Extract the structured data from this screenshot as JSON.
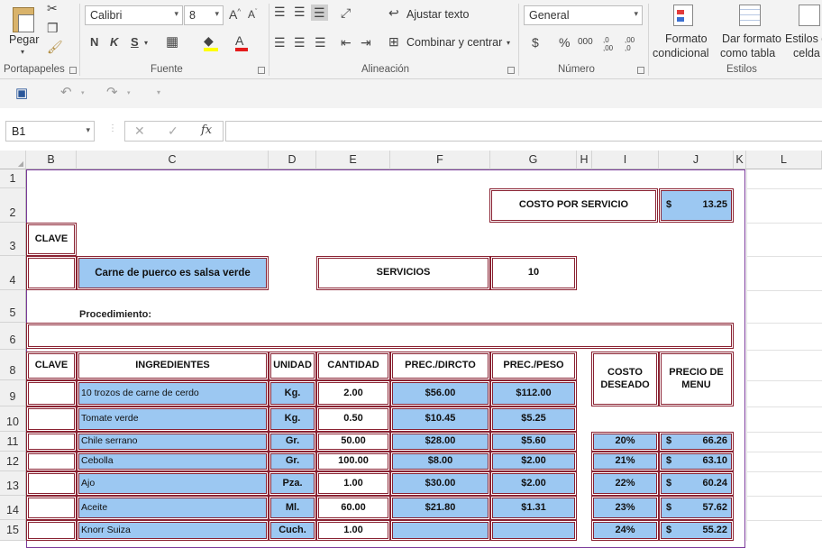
{
  "ribbon": {
    "clipboard": {
      "paste_label": "Pegar",
      "group_label": "Portapapeles"
    },
    "font": {
      "family": "Calibri",
      "size": "8",
      "group_label": "Fuente",
      "bold": "N",
      "italic": "K",
      "underline": "S"
    },
    "alignment": {
      "wrap_text": "Ajustar texto",
      "merge_center": "Combinar y centrar",
      "group_label": "Alineación"
    },
    "number": {
      "format": "General",
      "currency": "$",
      "percent": "%",
      "thousands": "000",
      "inc_decimals": ",0 ,00",
      "dec_decimals": ",00 ,0",
      "group_label": "Número"
    },
    "styles": {
      "cond_format_1": "Formato",
      "cond_format_2": "condicional",
      "table_format_1": "Dar formato",
      "table_format_2": "como tabla",
      "cell_styles_1": "Estilos de",
      "cell_styles_2": "celda",
      "group_label": "Estilos"
    }
  },
  "formula_bar": {
    "name_box": "B1",
    "fx": "fx",
    "formula": ""
  },
  "columns": [
    "B",
    "C",
    "D",
    "E",
    "F",
    "G",
    "H",
    "I",
    "J",
    "K",
    "L"
  ],
  "rows": [
    "1",
    "2",
    "3",
    "4",
    "5",
    "6",
    "8",
    "9",
    "10",
    "11",
    "12",
    "13",
    "14",
    "15"
  ],
  "sheet": {
    "costo_servicio_label": "COSTO POR SERVICIO",
    "costo_servicio_currency": "$",
    "costo_servicio_value": "13.25",
    "clave_label": "CLAVE",
    "dish_name": "Carne de puerco es salsa verde",
    "servicios_label": "SERVICIOS",
    "servicios_value": "10",
    "procedimiento_label": "Procedimiento:",
    "table_headers": {
      "clave": "CLAVE",
      "ingredientes": "INGREDIENTES",
      "unidad": "UNIDAD",
      "cantidad": "CANTIDAD",
      "prec_directo": "PREC./DIRCTO",
      "prec_peso": "PREC./PESO"
    },
    "side_headers": {
      "costo_deseado": "COSTO DESEADO",
      "precio_menu": "PRECIO DE MENU"
    },
    "ingredients": [
      {
        "name": "10 trozos de carne de cerdo",
        "unit": "Kg.",
        "qty": "2.00",
        "direct": "$56.00",
        "weight": "$112.00"
      },
      {
        "name": "Tomate verde",
        "unit": "Kg.",
        "qty": "0.50",
        "direct": "$10.45",
        "weight": "$5.25"
      },
      {
        "name": "Chile serrano",
        "unit": "Gr.",
        "qty": "50.00",
        "direct": "$28.00",
        "weight": "$5.60"
      },
      {
        "name": "Cebolla",
        "unit": "Gr.",
        "qty": "100.00",
        "direct": "$8.00",
        "weight": "$2.00"
      },
      {
        "name": "Ajo",
        "unit": "Pza.",
        "qty": "1.00",
        "direct": "$30.00",
        "weight": "$2.00"
      },
      {
        "name": "Aceite",
        "unit": "Ml.",
        "qty": "60.00",
        "direct": "$21.80",
        "weight": "$1.31"
      },
      {
        "name": "Knorr Suiza",
        "unit": "Cuch.",
        "qty": "1.00",
        "direct": "",
        "weight": ""
      }
    ],
    "menu_prices": [
      {
        "pct": "20%",
        "cur": "$",
        "price": "66.26"
      },
      {
        "pct": "21%",
        "cur": "$",
        "price": "63.10"
      },
      {
        "pct": "22%",
        "cur": "$",
        "price": "60.24"
      },
      {
        "pct": "23%",
        "cur": "$",
        "price": "57.62"
      },
      {
        "pct": "24%",
        "cur": "$",
        "price": "55.22"
      }
    ]
  }
}
